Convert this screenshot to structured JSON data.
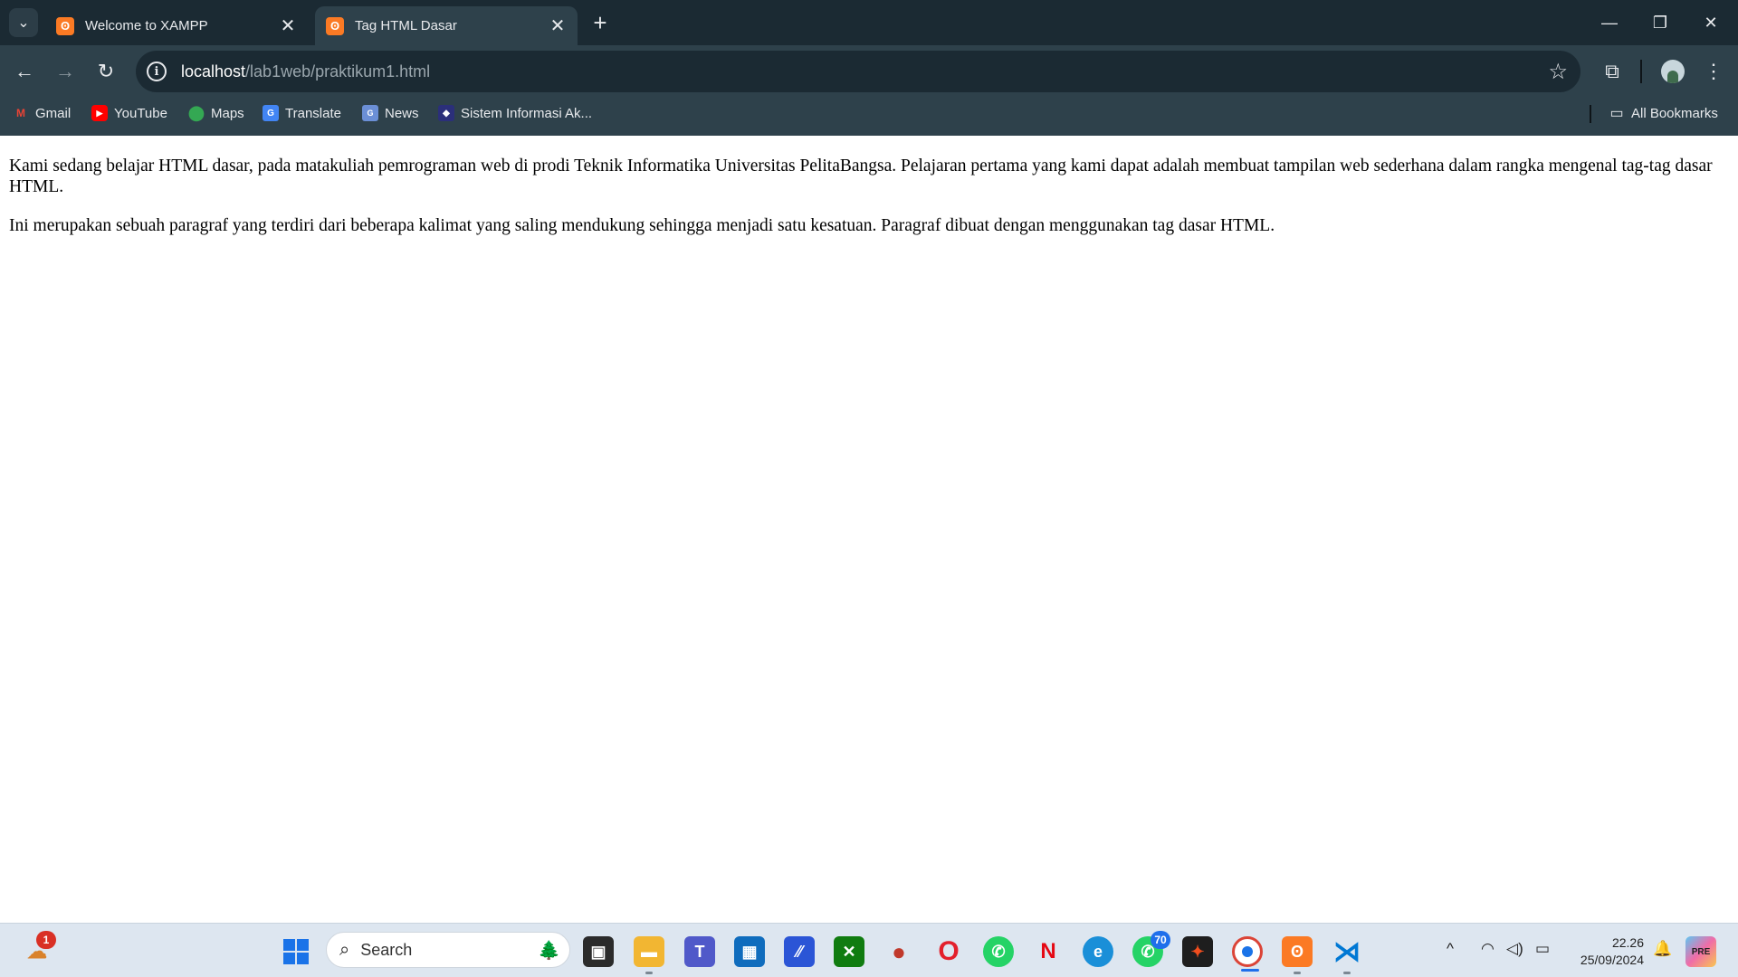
{
  "browser": {
    "tabs": [
      {
        "title": "Welcome to XAMPP",
        "active": false
      },
      {
        "title": "Tag HTML Dasar",
        "active": true
      }
    ],
    "address": {
      "host": "localhost",
      "path": "/lab1web/praktikum1.html"
    },
    "bookmarks": [
      "Gmail",
      "YouTube",
      "Maps",
      "Translate",
      "News",
      "Sistem Informasi Ak..."
    ],
    "all_bookmarks_label": "All Bookmarks"
  },
  "page": {
    "paragraphs": [
      "Kami sedang belajar HTML dasar, pada matakuliah pemrograman web di prodi Teknik Informatika Universitas PelitaBangsa. Pelajaran pertama yang kami dapat adalah membuat tampilan web sederhana dalam rangka mengenal tag-tag dasar HTML.",
      "Ini merupakan sebuah paragraf yang terdiri dari beberapa kalimat yang saling mendukung sehingga menjadi satu kesatuan. Paragraf dibuat dengan menggunakan tag dasar HTML."
    ]
  },
  "taskbar": {
    "search_label": "Search",
    "weather_badge": "1",
    "whatsapp_badge": "70",
    "time": "22.26",
    "date": "25/09/2024"
  },
  "colors": {
    "titlebar": "#1b2a33",
    "toolbar": "#2e414b",
    "xampp": "#fb7a24",
    "taskbar": "#dde6f0"
  }
}
